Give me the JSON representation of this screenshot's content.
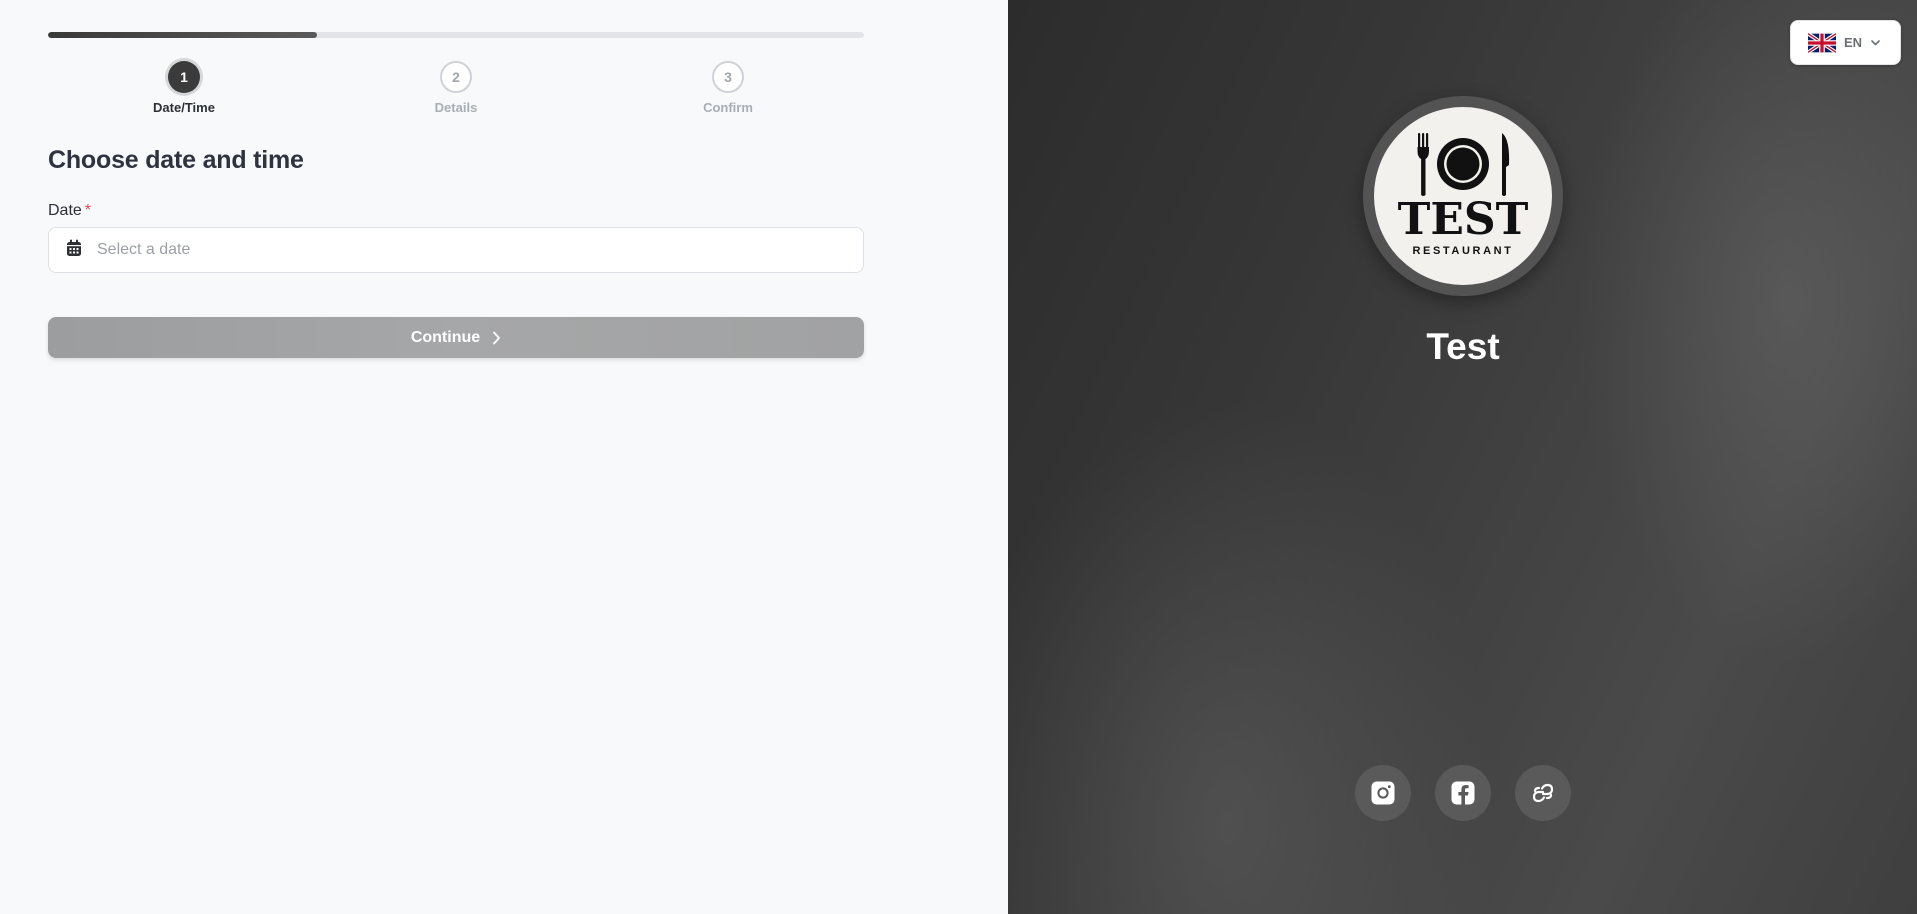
{
  "progress": {
    "current_step": 1,
    "total_steps": 3,
    "fraction": 0.33
  },
  "steps": [
    {
      "number": "1",
      "label": "Date/Time",
      "state": "active"
    },
    {
      "number": "2",
      "label": "Details",
      "state": "inactive"
    },
    {
      "number": "3",
      "label": "Confirm",
      "state": "inactive"
    }
  ],
  "form": {
    "heading": "Choose date and time",
    "date_label": "Date",
    "required_marker": "*",
    "date_placeholder": "Select a date",
    "date_value": "",
    "date_icon": "calendar-icon"
  },
  "continue_button": {
    "label": "Continue",
    "icon": "chevron-right-icon",
    "enabled": false
  },
  "language": {
    "code": "EN",
    "flag_icon": "uk-flag-icon",
    "dropdown_icon": "chevron-down-icon"
  },
  "restaurant": {
    "name": "Test",
    "logo": {
      "wordmark": "TEST",
      "subtitle": "RESTAURANT"
    }
  },
  "social_links": [
    {
      "name": "instagram",
      "icon": "instagram-icon"
    },
    {
      "name": "facebook",
      "icon": "facebook-icon"
    },
    {
      "name": "website",
      "icon": "link-icon"
    }
  ],
  "colors": {
    "primary_dark": "#3b3b3b",
    "required_red": "#e5484d",
    "button_disabled": "#a2a3a4",
    "panel_dark": "#3a3a3a"
  }
}
